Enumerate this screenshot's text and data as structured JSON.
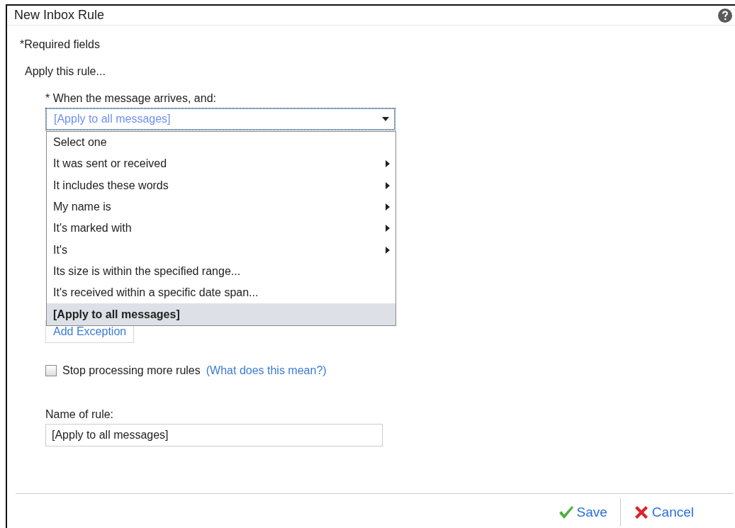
{
  "window": {
    "title": "New Inbox Rule"
  },
  "required_note": "*Required fields",
  "section_label": "Apply this rule...",
  "condition": {
    "label": "* When the message arrives, and:",
    "value": "[Apply to all messages]",
    "expanded": true,
    "options": [
      {
        "label": "Select one",
        "submenu": false,
        "selected": false
      },
      {
        "label": "It was sent or received",
        "submenu": true,
        "selected": false
      },
      {
        "label": "It includes these words",
        "submenu": true,
        "selected": false
      },
      {
        "label": "My name is",
        "submenu": true,
        "selected": false
      },
      {
        "label": "It's marked with",
        "submenu": true,
        "selected": false
      },
      {
        "label": "It's",
        "submenu": true,
        "selected": false
      },
      {
        "label": "Its size is within the specified range...",
        "submenu": false,
        "selected": false
      },
      {
        "label": "It's received within a specific date span...",
        "submenu": false,
        "selected": false
      },
      {
        "label": "[Apply to all messages]",
        "submenu": false,
        "selected": true
      }
    ]
  },
  "add_exception": "Add Exception",
  "stop_processing": {
    "label": "Stop processing more rules",
    "checked": false,
    "link": "(What does this mean?)"
  },
  "rule_name": {
    "label": "Name of rule:",
    "value": "[Apply to all messages]"
  },
  "buttons": [
    {
      "kind": "save",
      "label": "Save"
    },
    {
      "kind": "cancel",
      "label": "Cancel"
    }
  ]
}
